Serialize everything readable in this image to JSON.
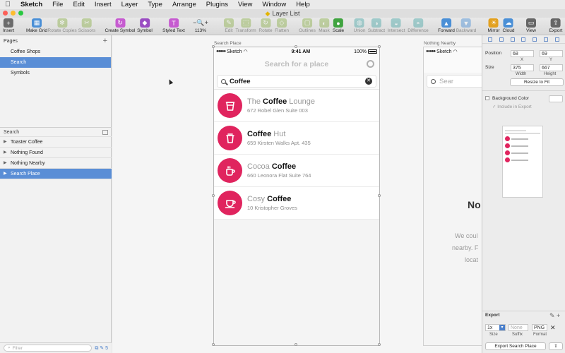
{
  "menubar": {
    "apple": "",
    "items": [
      "Sketch",
      "File",
      "Edit",
      "Insert",
      "Layer",
      "Type",
      "Arrange",
      "Plugins",
      "View",
      "Window",
      "Help"
    ]
  },
  "window": {
    "title": "Layer List"
  },
  "toolbar": {
    "items": [
      {
        "label": "Insert",
        "icon": "+",
        "color": "#6b6b6b"
      },
      {
        "label": "Make Grid",
        "icon": "▦",
        "color": "#4a8fd6"
      },
      {
        "label": "Rotate Copies",
        "icon": "✻",
        "color": "#8bb04a"
      },
      {
        "label": "Scissors",
        "icon": "✂",
        "color": "#8bb04a"
      },
      {
        "label": "Create Symbol",
        "icon": "↻",
        "color": "#c65bd0"
      },
      {
        "label": "Symbol",
        "icon": "◆",
        "color": "#9a4cc2"
      },
      {
        "label": "Styled Text",
        "icon": "T",
        "color": "#c65bd0"
      },
      {
        "label": "113%",
        "icon": "−🔍+",
        "color": "#666666"
      },
      {
        "label": "Edit",
        "icon": "✎",
        "color": "#8bb04a"
      },
      {
        "label": "Transform",
        "icon": "⬚",
        "color": "#8bb04a"
      },
      {
        "label": "Rotate",
        "icon": "↻",
        "color": "#8bb04a"
      },
      {
        "label": "Flatten",
        "icon": "◇",
        "color": "#8bb04a"
      },
      {
        "label": "Outlines",
        "icon": "▢",
        "color": "#8bb04a"
      },
      {
        "label": "Mask",
        "icon": "◐",
        "color": "#8bb04a"
      },
      {
        "label": "Scale",
        "icon": "●",
        "color": "#3fa33f"
      },
      {
        "label": "Union",
        "icon": "◍",
        "color": "#4aa7a7"
      },
      {
        "label": "Subtract",
        "icon": "◑",
        "color": "#4aa7a7"
      },
      {
        "label": "Intersect",
        "icon": "◒",
        "color": "#4aa7a7"
      },
      {
        "label": "Difference",
        "icon": "◓",
        "color": "#4aa7a7"
      },
      {
        "label": "Forward",
        "icon": "▲",
        "color": "#4a8fd6"
      },
      {
        "label": "Backward",
        "icon": "▼",
        "color": "#4a8fd6"
      },
      {
        "label": "Mirror",
        "icon": "☀",
        "color": "#e3a11f"
      },
      {
        "label": "Cloud",
        "icon": "☁",
        "color": "#4a8fd6"
      },
      {
        "label": "View",
        "icon": "▭",
        "color": "#666666"
      },
      {
        "label": "Export",
        "icon": "⇪",
        "color": "#666666"
      }
    ]
  },
  "pages": {
    "header": "Pages",
    "add": "+",
    "items": [
      {
        "label": "Coffee Shops",
        "selected": false
      },
      {
        "label": "Search",
        "selected": true
      },
      {
        "label": "Symbols",
        "selected": false
      }
    ]
  },
  "layers": {
    "header": "Search",
    "items": [
      {
        "label": "Toaster Coffee",
        "selected": false
      },
      {
        "label": "Nothing Found",
        "selected": false
      },
      {
        "label": "Nothing Nearby",
        "selected": false
      },
      {
        "label": "Search Place",
        "selected": true
      }
    ],
    "filter_placeholder": "Filter",
    "filter_count": "5"
  },
  "canvas": {
    "artboard_label": "Search Place",
    "artboard2_label": "Nothing Nearby",
    "status": {
      "carrier": "Sketch",
      "time": "9:41 AM",
      "battery": "100%"
    },
    "nav_title": "Search for a place",
    "search_value": "Coffee",
    "search_clear": "✕",
    "results": [
      {
        "pre": "The ",
        "bold": "Coffee",
        "post": " Lounge",
        "address": "672 Robel Glen Suite 003",
        "icon": "cup"
      },
      {
        "pre": "",
        "bold": "Coffee",
        "post": " Hut",
        "address": "659 Kirsten Walks Apt. 435",
        "icon": "takeaway"
      },
      {
        "pre": "Cocoa ",
        "bold": "Coffee",
        "post": "",
        "address": "660 Leonora Flat Suite 764",
        "icon": "mug"
      },
      {
        "pre": "Cosy ",
        "bold": "Coffee",
        "post": "",
        "address": "10 Kristopher Groves",
        "icon": "cup-saucer"
      }
    ],
    "a2_search": "Sear",
    "a2_big": "No",
    "a2_lines": [
      "We coul",
      "nearby. F",
      "locat"
    ],
    "accent": "#e0245e"
  },
  "inspector": {
    "position_label": "Position",
    "x": "68",
    "y": "69",
    "x_label": "X",
    "y_label": "Y",
    "size_label": "Size",
    "width": "375",
    "height": "667",
    "width_label": "Width",
    "height_label": "Height",
    "resize_button": "Resize to Fit",
    "bg_label": "Background Color",
    "include_label": "Include in Export",
    "export_header": "Export",
    "scale": "1x",
    "suffix_placeholder": "None",
    "format": "PNG",
    "size_col": "Size",
    "suffix_col": "Suffix",
    "format_col": "Format",
    "export_button": "Export Search Place"
  }
}
